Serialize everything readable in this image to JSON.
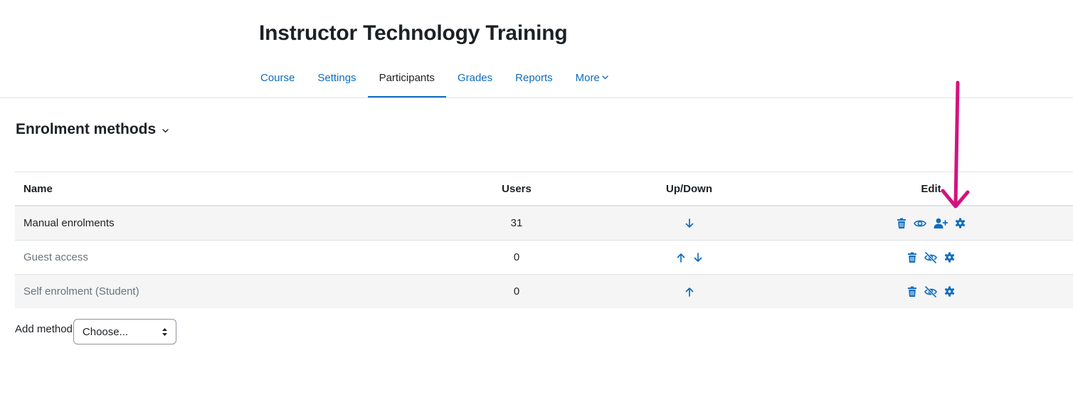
{
  "course": {
    "title": "Instructor Technology Training"
  },
  "nav": {
    "tabs": [
      {
        "label": "Course"
      },
      {
        "label": "Settings"
      },
      {
        "label": "Participants",
        "active": true
      },
      {
        "label": "Grades"
      },
      {
        "label": "Reports"
      },
      {
        "label": "More"
      }
    ]
  },
  "page": {
    "heading": "Enrolment methods"
  },
  "table": {
    "headers": {
      "name": "Name",
      "users": "Users",
      "updown": "Up/Down",
      "edit": "Edit"
    },
    "rows": [
      {
        "name": "Manual enrolments",
        "users": "31",
        "updown": [
          "arrow-down-icon"
        ],
        "edit": [
          "trash-icon",
          "eye-icon",
          "enrol-users-icon",
          "gear-icon"
        ]
      },
      {
        "name": "Guest access",
        "users": "0",
        "updown": [
          "arrow-up-icon",
          "arrow-down-icon"
        ],
        "edit": [
          "trash-icon",
          "eye-slash-icon",
          "gear-icon"
        ]
      },
      {
        "name": "Self enrolment (Student)",
        "users": "0",
        "updown": [
          "arrow-up-icon"
        ],
        "edit": [
          "trash-icon",
          "eye-slash-icon",
          "gear-icon"
        ]
      }
    ]
  },
  "add_method": {
    "label": "Add method",
    "selected": "Choose..."
  },
  "colors": {
    "link": "#0f6cbf",
    "text": "#1d2125",
    "muted": "#6a737b",
    "annotation": "#d3137e",
    "stripe": "#f5f5f5"
  }
}
